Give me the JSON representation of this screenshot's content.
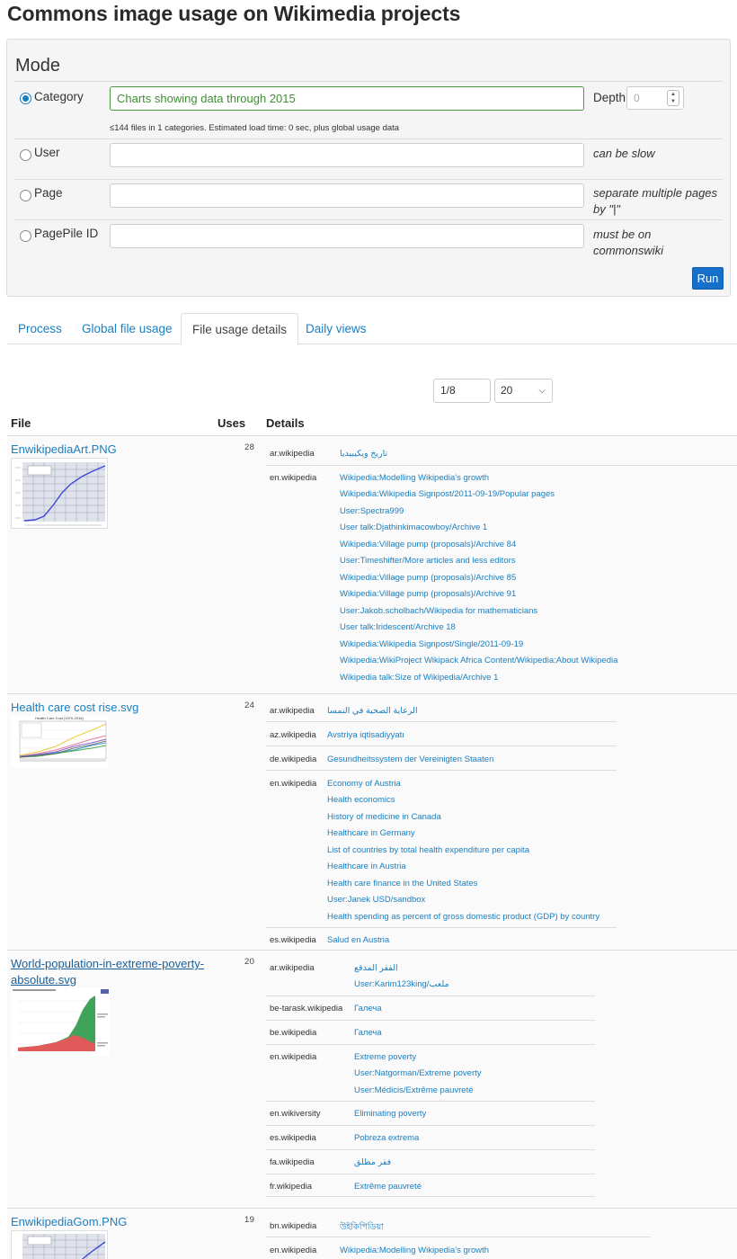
{
  "page": {
    "title": "Commons image usage on Wikimedia projects"
  },
  "mode": {
    "title": "Mode",
    "category": {
      "label": "Category",
      "value": "Charts showing data through 2015",
      "depth_label": "Depth",
      "depth_value": "0",
      "hint": "≤144 files in 1 categories. Estimated load time: 0 sec, plus global usage data"
    },
    "user": {
      "label": "User",
      "value": "",
      "note": "can be slow"
    },
    "page": {
      "label": "Page",
      "value": "",
      "note_line1": "separate multiple pages",
      "note_line2": "by \"|\""
    },
    "pagepile": {
      "label": "PagePile ID",
      "value": "",
      "note": "must be on commonswiki"
    },
    "run_label": "Run"
  },
  "tabs": [
    {
      "label": "Process"
    },
    {
      "label": "Global file usage"
    },
    {
      "label": "File usage details",
      "active": true
    },
    {
      "label": "Daily views"
    }
  ],
  "pager": {
    "page": "1/8",
    "per_page": "20"
  },
  "table": {
    "headers": {
      "file": "File",
      "uses": "Uses",
      "details": "Details"
    },
    "rows": [
      {
        "file": "EnwikipediaArt.PNG",
        "uses": "28",
        "groups": [
          {
            "wiki": "ar.wikipedia",
            "pages": [
              "تاريخ ويكيبيديا"
            ]
          },
          {
            "wiki": "en.wikipedia",
            "pages": [
              "Wikipedia:Modelling Wikipedia's growth",
              "Wikipedia:Wikipedia Signpost/2011-09-19/Popular pages",
              "User:Spectra999",
              "User talk:Djathinkimacowboy/Archive 1",
              "Wikipedia:Village pump (proposals)/Archive 84",
              "User:Timeshifter/More articles and less editors",
              "Wikipedia:Village pump (proposals)/Archive 85",
              "Wikipedia:Village pump (proposals)/Archive 91",
              "User:Jakob.scholbach/Wikipedia for mathematicians",
              "User talk:Iridescent/Archive 18",
              "Wikipedia:Wikipedia Signpost/Single/2011-09-19",
              "Wikipedia:WikiProject Wikipack Africa Content/Wikipedia:About Wikipedia",
              "Wikipedia talk:Size of Wikipedia/Archive 1"
            ]
          }
        ]
      },
      {
        "file": "Health care cost rise.svg",
        "uses": "24",
        "thumb_title": "Health Care Cost (1970-2016)",
        "groups": [
          {
            "wiki": "ar.wikipedia",
            "pages": [
              "الرعاية الصحية في النمسا"
            ]
          },
          {
            "wiki": "az.wikipedia",
            "pages": [
              "Avstriya iqtisadiyyatı"
            ]
          },
          {
            "wiki": "de.wikipedia",
            "pages": [
              "Gesundheitssystem der Vereinigten Staaten"
            ]
          },
          {
            "wiki": "en.wikipedia",
            "pages": [
              "Economy of Austria",
              "Health economics",
              "History of medicine in Canada",
              "Healthcare in Germany",
              "List of countries by total health expenditure per capita",
              "Healthcare in Austria",
              "Health care finance in the United States",
              "User:Janek USD/sandbox",
              "Health spending as percent of gross domestic product (GDP) by country"
            ]
          },
          {
            "wiki": "es.wikipedia",
            "pages": [
              "Salud en Austria"
            ]
          }
        ]
      },
      {
        "file_line1": "World-population-in-extreme-poverty-",
        "file_line2": "absolute.svg",
        "uses": "20",
        "groups": [
          {
            "wiki": "ar.wikipedia",
            "pages": [
              "الفقر المدقع",
              "User:Karim123king/ملعب"
            ]
          },
          {
            "wiki": "be-tarask.wikipedia",
            "pages": [
              "Галеча"
            ]
          },
          {
            "wiki": "be.wikipedia",
            "pages": [
              "Галеча"
            ]
          },
          {
            "wiki": "en.wikipedia",
            "pages": [
              "Extreme poverty",
              "User:Natgorman/Extreme poverty",
              "User:Médicis/Extrême pauvreté"
            ]
          },
          {
            "wiki": "en.wikiversity",
            "pages": [
              "Eliminating poverty"
            ]
          },
          {
            "wiki": "es.wikipedia",
            "pages": [
              "Pobreza extrema"
            ]
          },
          {
            "wiki": "fa.wikipedia",
            "pages": [
              "فقر مطلق"
            ]
          },
          {
            "wiki": "fr.wikipedia",
            "pages": [
              "Extrême pauvreté"
            ]
          }
        ]
      },
      {
        "file": "EnwikipediaGom.PNG",
        "uses": "19",
        "groups": [
          {
            "wiki": "bn.wikipedia",
            "pages": [
              "উইকিপিডিয়া"
            ]
          },
          {
            "wiki": "en.wikipedia",
            "pages": [
              "Wikipedia:Modelling Wikipedia's growth"
            ]
          }
        ]
      }
    ]
  },
  "colors": {
    "link": "#1a7fc1",
    "run_button": "#1670c9",
    "active_input": "#4a9a3e"
  }
}
